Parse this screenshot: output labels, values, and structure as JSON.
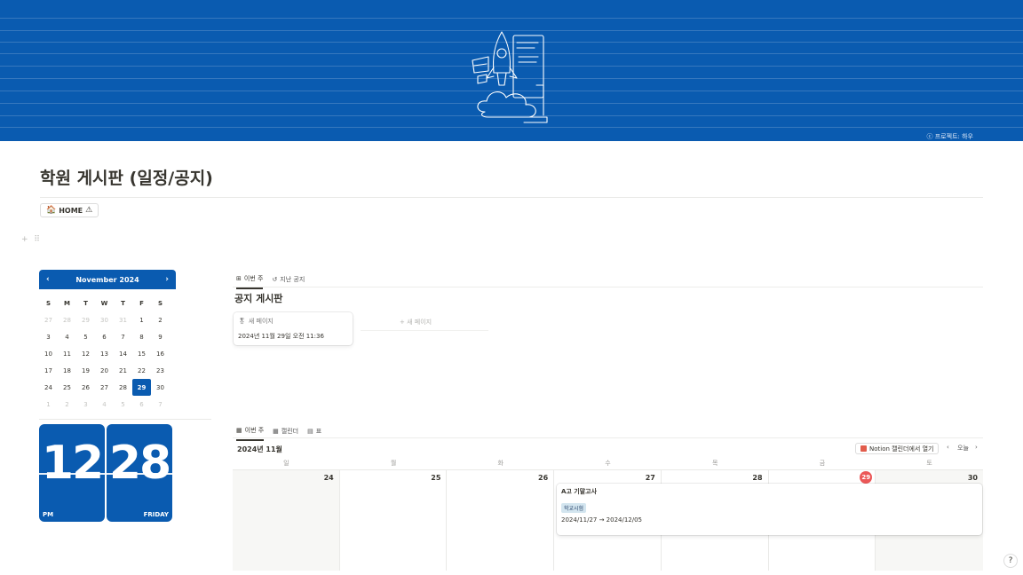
{
  "cover": {
    "credit": "ⓒ 프로젝트: 하우",
    "bg_color": "#0a5bb0"
  },
  "page": {
    "title": "학원 게시판 (일정/공지)",
    "home_label": "HOME",
    "home_icon": "house-icon",
    "home_badge": "warning-icon"
  },
  "mini_calendar": {
    "month_label": "November 2024",
    "weekdays": [
      "S",
      "M",
      "T",
      "W",
      "T",
      "F",
      "S"
    ],
    "days": [
      {
        "d": "27",
        "m": true
      },
      {
        "d": "28",
        "m": true
      },
      {
        "d": "29",
        "m": true
      },
      {
        "d": "30",
        "m": true
      },
      {
        "d": "31",
        "m": true
      },
      {
        "d": "1"
      },
      {
        "d": "2"
      },
      {
        "d": "3"
      },
      {
        "d": "4"
      },
      {
        "d": "5"
      },
      {
        "d": "6"
      },
      {
        "d": "7"
      },
      {
        "d": "8"
      },
      {
        "d": "9"
      },
      {
        "d": "10"
      },
      {
        "d": "11"
      },
      {
        "d": "12"
      },
      {
        "d": "13"
      },
      {
        "d": "14"
      },
      {
        "d": "15"
      },
      {
        "d": "16"
      },
      {
        "d": "17"
      },
      {
        "d": "18"
      },
      {
        "d": "19"
      },
      {
        "d": "20"
      },
      {
        "d": "21"
      },
      {
        "d": "22"
      },
      {
        "d": "23"
      },
      {
        "d": "24"
      },
      {
        "d": "25"
      },
      {
        "d": "26"
      },
      {
        "d": "27"
      },
      {
        "d": "28"
      },
      {
        "d": "29",
        "t": true
      },
      {
        "d": "30"
      },
      {
        "d": "1",
        "m": true
      },
      {
        "d": "2",
        "m": true
      },
      {
        "d": "3",
        "m": true
      },
      {
        "d": "4",
        "m": true
      },
      {
        "d": "5",
        "m": true
      },
      {
        "d": "6",
        "m": true
      },
      {
        "d": "7",
        "m": true
      }
    ]
  },
  "clock": {
    "hour": "12",
    "minute": "28",
    "ampm": "PM",
    "weekday": "FRIDAY"
  },
  "notice": {
    "tab_current": "이번 주",
    "tab_past": "지난 공지",
    "title": "공지 게시판",
    "card_title": "새 페이지",
    "card_date": "2024년 11월 29일 오전 11:36",
    "new_page": "+ 새 페이지"
  },
  "schedule": {
    "tab_week": "이번 주",
    "tab_calendar": "캘린더",
    "tab_table": "표",
    "month": "2024년 11월",
    "open_notion": "Notion 캘린더에서 열기",
    "today_label": "오늘",
    "weekdays": [
      "일",
      "월",
      "화",
      "수",
      "목",
      "금",
      "토"
    ],
    "dates": [
      "24",
      "25",
      "26",
      "27",
      "28",
      "29",
      "30"
    ],
    "today_index": 5,
    "event": {
      "title": "A고 기말고사",
      "tag": "학교시험",
      "range": "2024/11/27 → 2024/12/05"
    }
  }
}
